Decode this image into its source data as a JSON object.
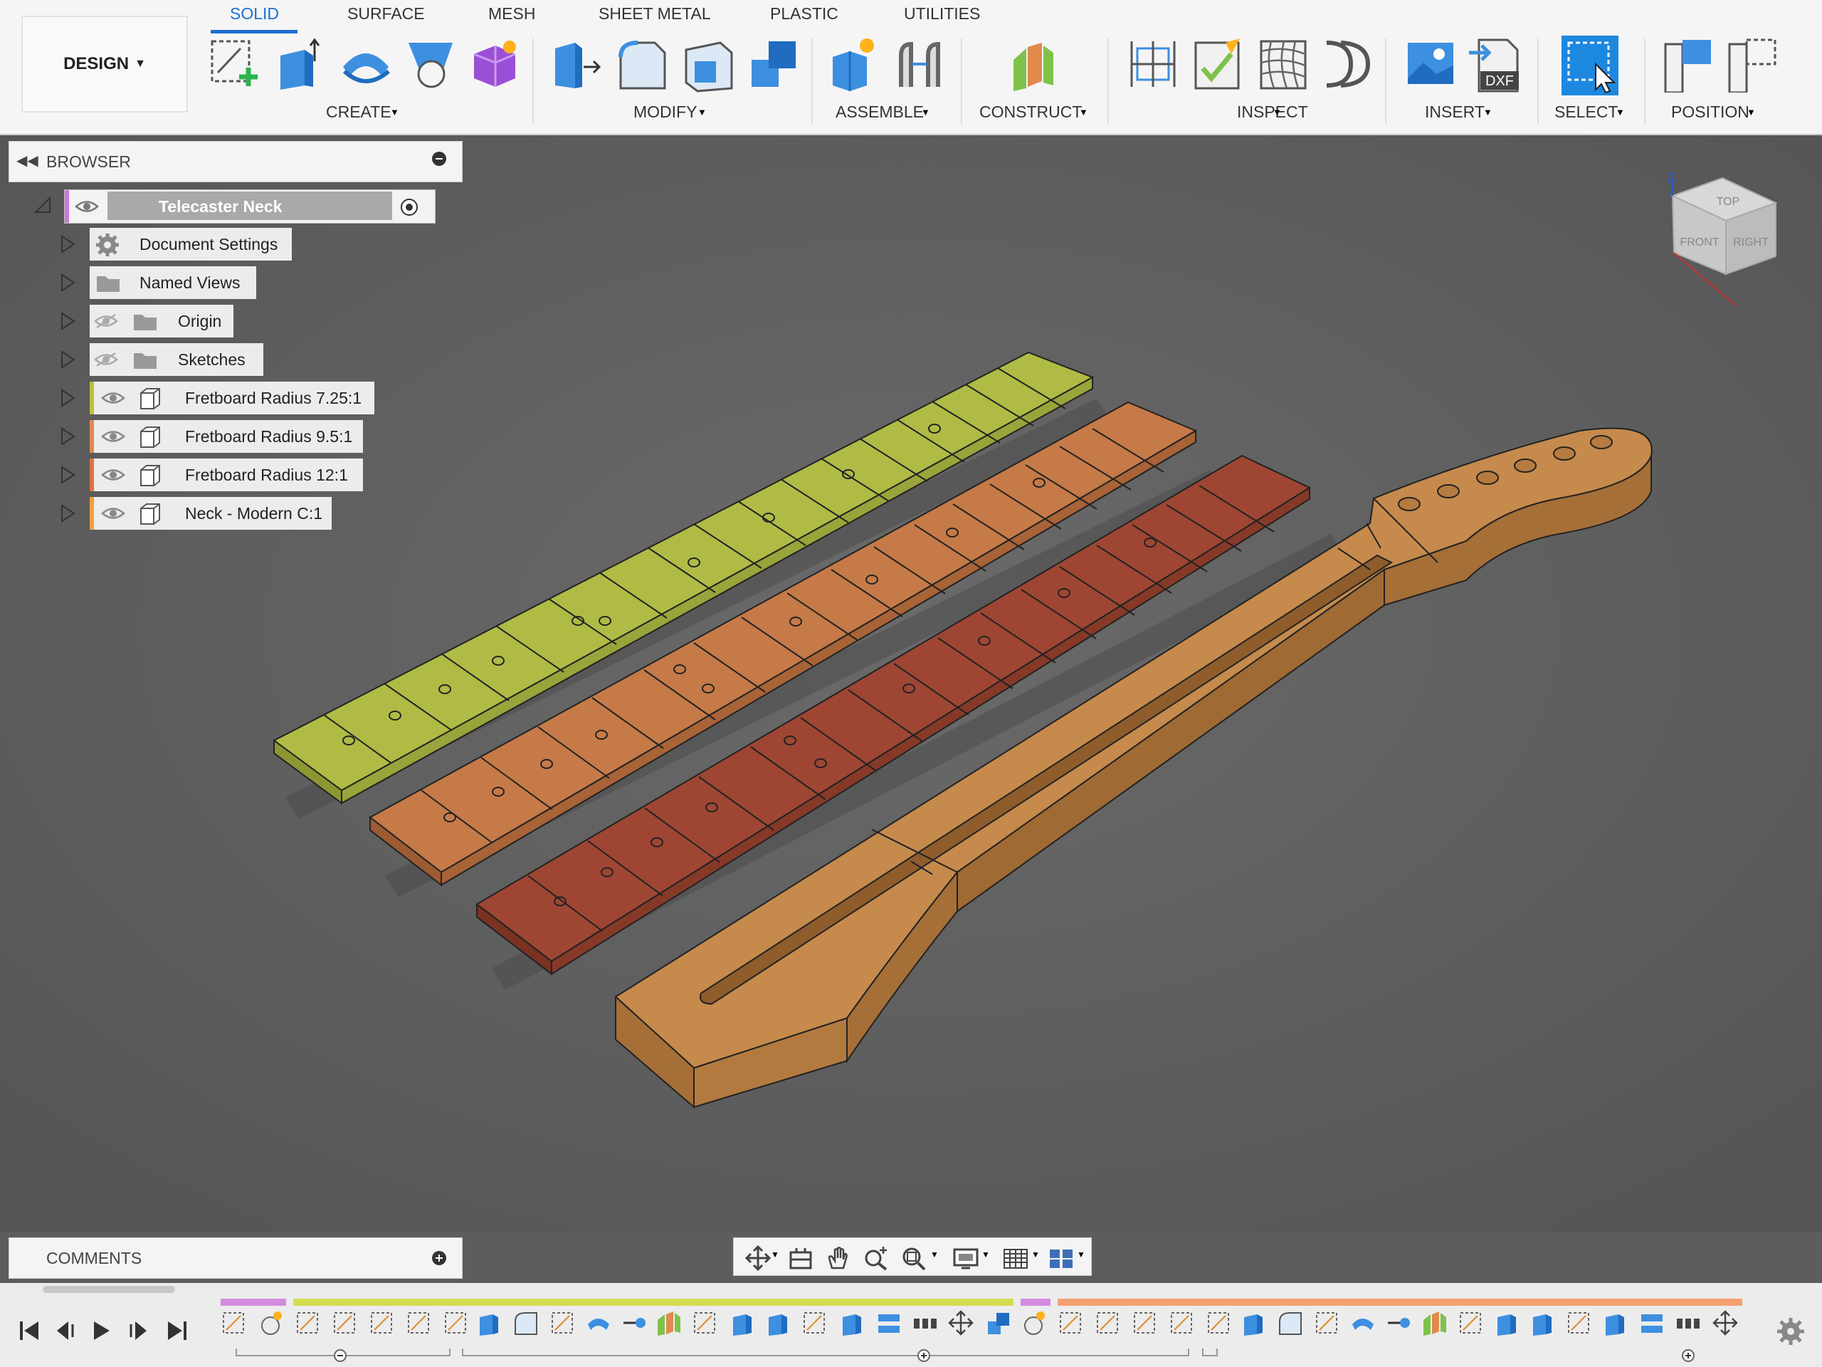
{
  "toolbar": {
    "workspace": "DESIGN",
    "tabs": [
      "SOLID",
      "SURFACE",
      "MESH",
      "SHEET METAL",
      "PLASTIC",
      "UTILITIES"
    ],
    "groups": [
      "CREATE",
      "MODIFY",
      "ASSEMBLE",
      "CONSTRUCT",
      "INSPECT",
      "INSERT",
      "SELECT",
      "POSITION"
    ],
    "insert_dxf_label": "DXF",
    "accent": "#1d6fd3"
  },
  "browser": {
    "title": "BROWSER",
    "root": "Telecaster Neck",
    "items": [
      {
        "label": "Document Settings",
        "icon": "gear-icon"
      },
      {
        "label": "Named Views",
        "icon": "folder-icon"
      },
      {
        "label": "Origin",
        "icon": "folder-icon",
        "hidden": true
      },
      {
        "label": "Sketches",
        "icon": "folder-icon",
        "hidden": true
      },
      {
        "label": "Fretboard Radius 7.25:1",
        "icon": "body-icon",
        "color": "#b8c23a"
      },
      {
        "label": "Fretboard Radius 9.5:1",
        "icon": "body-icon",
        "color": "#e08a4e"
      },
      {
        "label": "Fretboard Radius 12:1",
        "icon": "body-icon",
        "color": "#e0713f"
      },
      {
        "label": "Neck - Modern C:1",
        "icon": "body-icon",
        "color": "#f0a040"
      }
    ]
  },
  "viewcube": {
    "top": "TOP",
    "front": "FRONT",
    "right": "RIGHT",
    "axis": "Z"
  },
  "comments": {
    "title": "COMMENTS"
  },
  "viewport": {
    "colors": {
      "fret725": "#b0bb45",
      "fret95": "#c57a48",
      "fret12": "#9e4633",
      "neck": "#c68a4c"
    }
  }
}
